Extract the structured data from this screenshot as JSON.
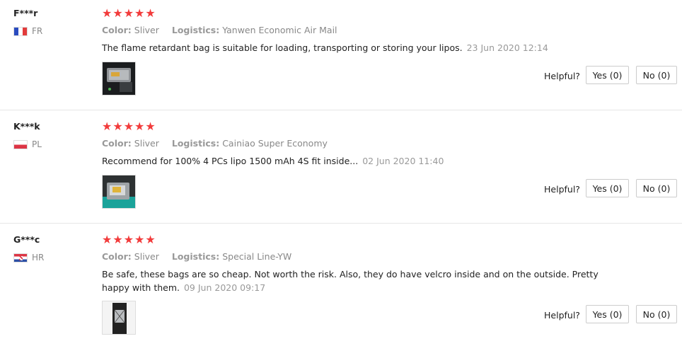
{
  "reviews": [
    {
      "user": "F***r",
      "country_code": "FR",
      "flag_icon": "france-flag-icon",
      "rating": 5,
      "attrs": [
        {
          "label": "Color:",
          "value": "Sliver"
        },
        {
          "label": "Logistics:",
          "value": "Yanwen Economic Air Mail"
        }
      ],
      "text": "The flame retardant bag is suitable for loading, transporting or storing your lipos.",
      "date": "23 Jun 2020 12:14",
      "helpful_label": "Helpful?",
      "yes_label": "Yes (0)",
      "no_label": "No (0)"
    },
    {
      "user": "K***k",
      "country_code": "PL",
      "flag_icon": "poland-flag-icon",
      "rating": 5,
      "attrs": [
        {
          "label": "Color:",
          "value": "Sliver"
        },
        {
          "label": "Logistics:",
          "value": "Cainiao Super Economy"
        }
      ],
      "text": "Recommend for 100% 4 PCs lipo 1500 mAh 4S fit inside...",
      "date": "02 Jun 2020 11:40",
      "helpful_label": "Helpful?",
      "yes_label": "Yes (0)",
      "no_label": "No (0)"
    },
    {
      "user": "G***c",
      "country_code": "HR",
      "flag_icon": "croatia-flag-icon",
      "rating": 5,
      "attrs": [
        {
          "label": "Color:",
          "value": "Sliver"
        },
        {
          "label": "Logistics:",
          "value": "Special Line-YW"
        }
      ],
      "text": "Be safe, these bags are so cheap. Not worth the risk. Also, they do have velcro inside and on the outside. Pretty happy with them.",
      "date": "09 Jun 2020 09:17",
      "helpful_label": "Helpful?",
      "yes_label": "Yes (0)",
      "no_label": "No (0)"
    }
  ],
  "colors": {
    "star": "#f23b3b",
    "muted_text": "#888888",
    "divider": "#e6e6e6"
  }
}
